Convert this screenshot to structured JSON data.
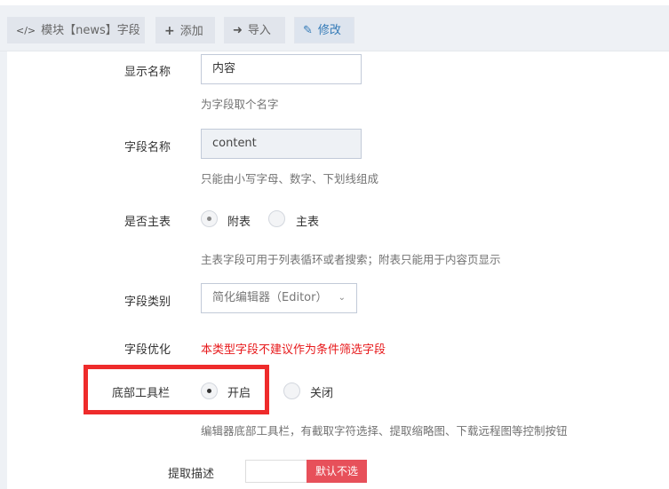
{
  "toolbar": {
    "module_tab": {
      "icon": "code-icon",
      "label": "模块【news】字段"
    },
    "add_tab": {
      "icon": "plus-icon",
      "label": "添加"
    },
    "import_tab": {
      "icon": "sign-in-icon",
      "label": "导入"
    },
    "edit_tab": {
      "icon": "edit-icon",
      "label": "修改"
    }
  },
  "form": {
    "display_name": {
      "label": "显示名称",
      "value": "内容",
      "help": "为字段取个名字"
    },
    "field_name": {
      "label": "字段名称",
      "value": "content",
      "help": "只能由小写字母、数字、下划线组成"
    },
    "is_main_table": {
      "label": "是否主表",
      "options": [
        "附表",
        "主表"
      ],
      "selected": "附表",
      "help": "主表字段可用于列表循环或者搜索；附表只能用于内容页显示"
    },
    "field_type": {
      "label": "字段类别",
      "value": "简化编辑器（Editor）"
    },
    "field_optimize": {
      "label": "字段优化",
      "warning": "本类型字段不建议作为条件筛选字段"
    },
    "bottom_toolbar": {
      "label": "底部工具栏",
      "options": [
        "开启",
        "关闭"
      ],
      "selected": "开启",
      "help": "编辑器底部工具栏，有截取字符选择、提取缩略图、下载远程图等控制按钮"
    },
    "extract_desc": {
      "label": "提取描述",
      "toggle_text": "默认不选"
    }
  },
  "colors": {
    "accent": "#337ab7",
    "highlight": "#ee2b2b",
    "warning": "#e7191b",
    "toggle_off": "#e7505a"
  }
}
